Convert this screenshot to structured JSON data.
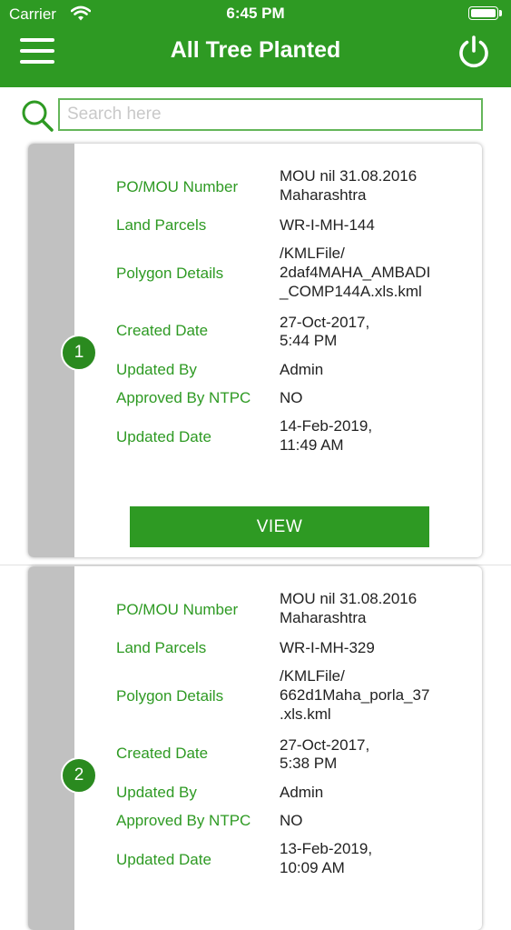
{
  "status_bar": {
    "carrier": "Carrier",
    "time": "6:45 PM"
  },
  "header": {
    "title": "All Tree Planted",
    "menu_icon": "hamburger-menu-icon",
    "power_icon": "power-icon"
  },
  "search": {
    "placeholder": "Search here",
    "icon": "search-icon"
  },
  "labels": {
    "po_mou": "PO/MOU Number",
    "land_parcels": "Land Parcels",
    "polygon_details": "Polygon Details",
    "created_date": "Created Date",
    "updated_by": "Updated By",
    "approved_by": "Approved By NTPC",
    "updated_date": "Updated Date",
    "view_button": "VIEW"
  },
  "records": [
    {
      "index": "1",
      "po_mou": [
        "MOU nil 31.08.2016",
        "Maharashtra"
      ],
      "land_parcels": "WR-I-MH-144",
      "polygon_details": [
        "/KMLFile/",
        "2daf4MAHA_AMBADI",
        "_COMP144A.xls.kml"
      ],
      "created_date": [
        "27-Oct-2017,",
        "5:44 PM"
      ],
      "updated_by": "Admin",
      "approved_by": "NO",
      "updated_date": [
        "14-Feb-2019,",
        "11:49 AM"
      ]
    },
    {
      "index": "2",
      "po_mou": [
        "MOU nil 31.08.2016",
        "Maharashtra"
      ],
      "land_parcels": "WR-I-MH-329",
      "polygon_details": [
        "/KMLFile/",
        "662d1Maha_porla_37",
        ".xls.kml"
      ],
      "created_date": [
        "27-Oct-2017,",
        "5:38 PM"
      ],
      "updated_by": "Admin",
      "approved_by": "NO",
      "updated_date": [
        "13-Feb-2019,",
        "10:09 AM"
      ]
    }
  ],
  "colors": {
    "brand": "#2e9a23",
    "strip": "#c1c1c1",
    "badge": "#2a8a1f"
  }
}
